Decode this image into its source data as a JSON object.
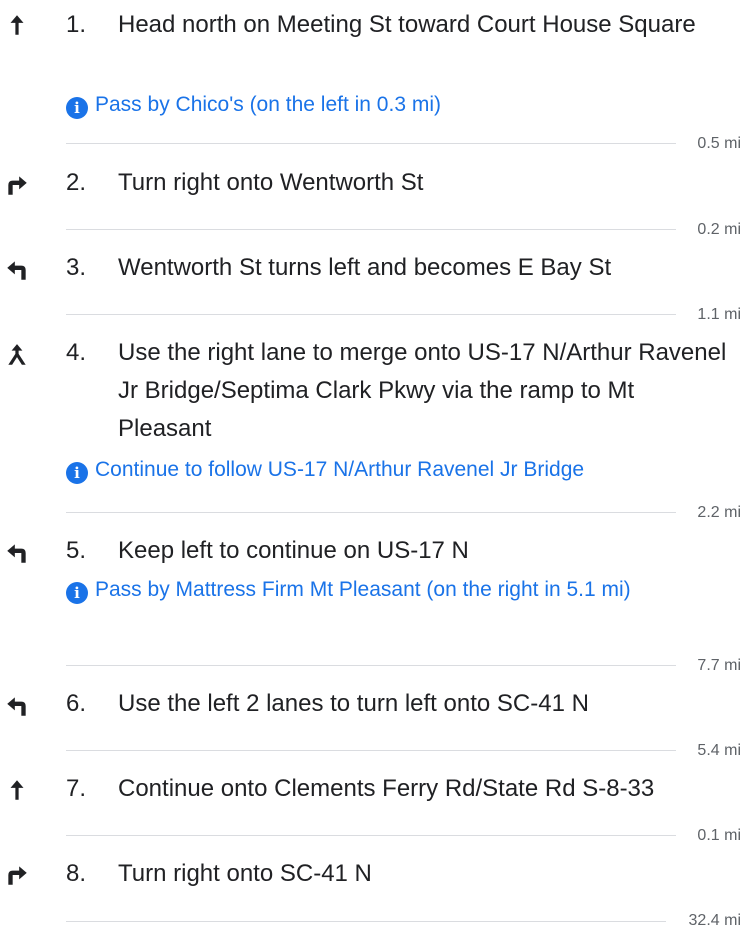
{
  "steps": [
    {
      "num": "1.",
      "icon": "straight-arrow-icon",
      "text": "Head north on Meeting St toward Court House Square",
      "note": "Pass by Chico's (on the left in 0.3 mi)",
      "distance": "0.5 mi"
    },
    {
      "num": "2.",
      "icon": "turn-right-icon",
      "text": "Turn right onto Wentworth St",
      "distance": "0.2 mi"
    },
    {
      "num": "3.",
      "icon": "turn-left-icon",
      "text": "Wentworth St turns left and becomes E Bay St",
      "distance": "1.1 mi"
    },
    {
      "num": "4.",
      "icon": "merge-icon",
      "text": "Use the right lane to merge onto US-17 N/Arthur Ravenel Jr Bridge/Septima Clark Pkwy via the ramp to Mt Pleasant",
      "note": "Continue to follow US-17 N/Arthur Ravenel Jr Bridge",
      "distance": "2.2 mi"
    },
    {
      "num": "5.",
      "icon": "keep-left-icon",
      "text": "Keep left to continue on US-17 N",
      "note": "Pass by Mattress Firm Mt Pleasant (on the right in 5.1 mi)",
      "distance": "7.7 mi"
    },
    {
      "num": "6.",
      "icon": "turn-left-icon",
      "text": "Use the left 2 lanes to turn left onto SC-41 N",
      "distance": "5.4 mi"
    },
    {
      "num": "7.",
      "icon": "straight-arrow-icon",
      "text": "Continue onto Clements Ferry Rd/State Rd S-8-33",
      "distance": "0.1 mi"
    },
    {
      "num": "8.",
      "icon": "turn-right-icon",
      "text": "Turn right onto SC-41 N",
      "distance": "32.4 mi"
    }
  ],
  "colors": {
    "link": "#1a73e8",
    "text": "#202124",
    "muted": "#5f6368",
    "divider": "#dadce0"
  },
  "info_glyph": "i"
}
